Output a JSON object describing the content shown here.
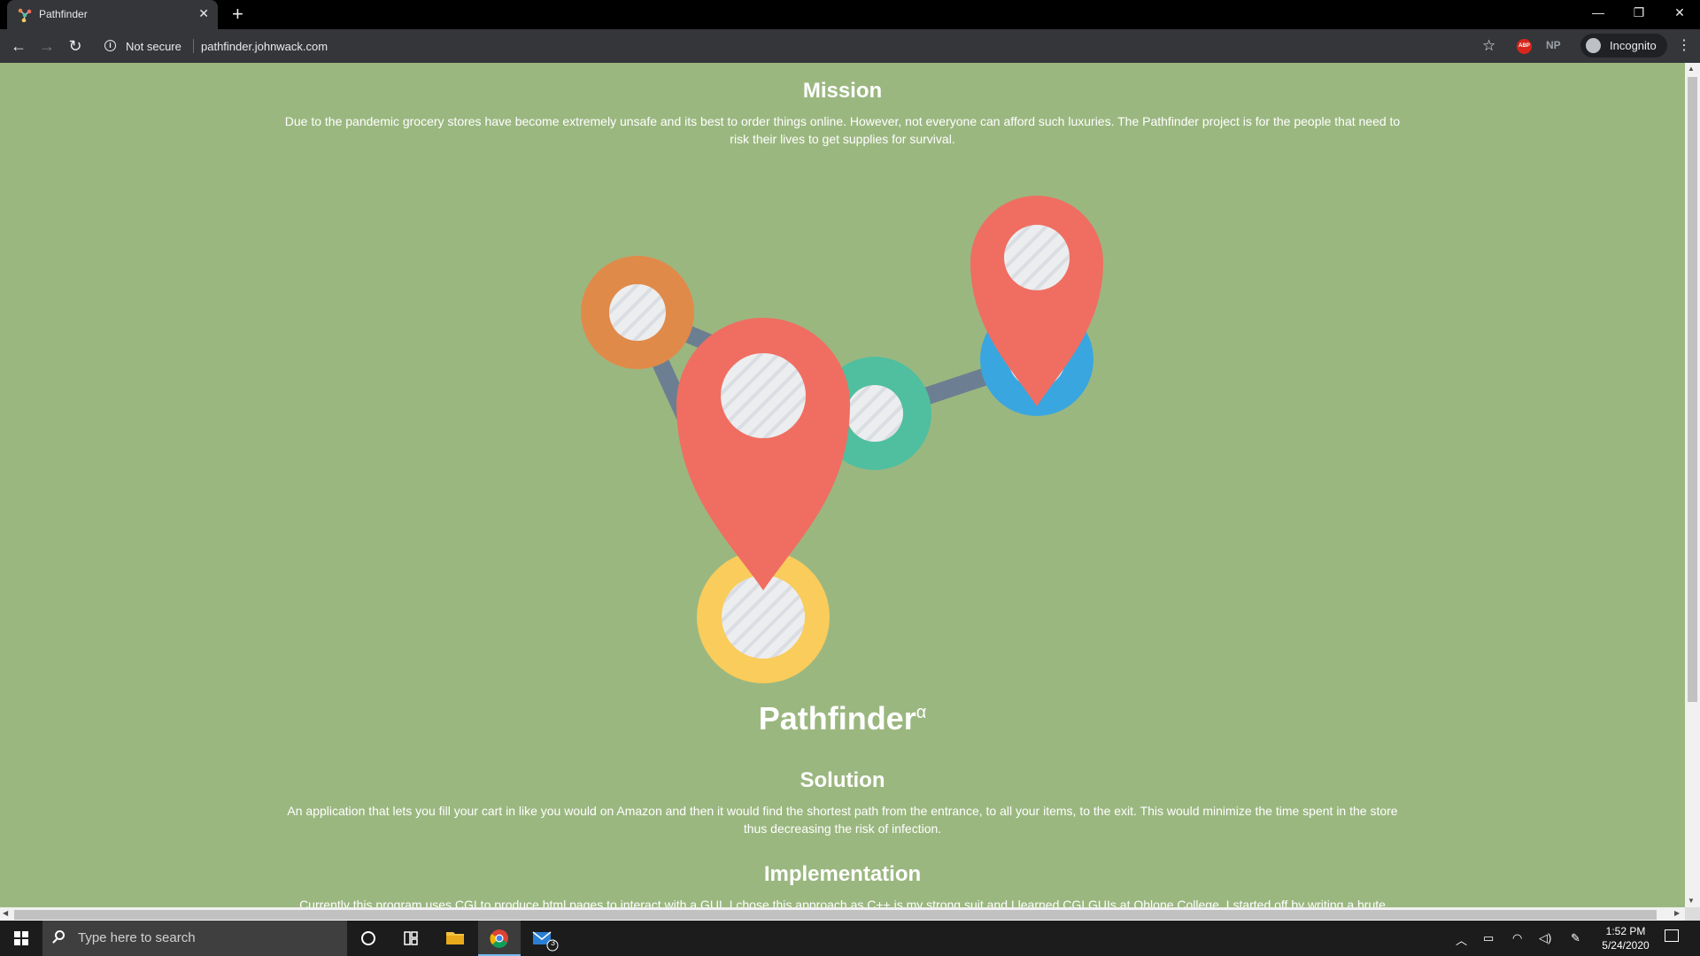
{
  "browser": {
    "tab_title": "Pathfinder",
    "tab_close": "✕",
    "new_tab": "+",
    "window": {
      "minimize": "—",
      "restore": "❐",
      "close": "✕"
    },
    "security_label": "Not secure",
    "url": "pathfinder.johnwack.com",
    "extension_np": "NP",
    "extension_abp": "ABP",
    "profile_label": "Incognito"
  },
  "page": {
    "mission_heading": "Mission",
    "mission_text": "Due to the pandemic grocery stores have become extremely unsafe and its best to order things online. However, not everyone can afford such luxuries. The Pathfinder project is for the people that need to risk their lives to get supplies for survival.",
    "brand_name": "Pathfinder",
    "brand_superscript": "α",
    "solution_heading": "Solution",
    "solution_text": "An application that lets you fill your cart in like you would on Amazon and then it would find the shortest path from the entrance, to all your items, to the exit. This would minimize the time spent in the store thus decreasing the risk of infection.",
    "implementation_heading": "Implementation",
    "implementation_text": "Currently this program uses CGI to produce html pages to interact with a GUI. I chose this approach as C++ is my strong suit and I learned CGI GUIs at Ohlone College. I started off by writing a brute"
  },
  "taskbar": {
    "search_placeholder": "Type here to search",
    "mail_badge": "3",
    "time": "1:52 PM",
    "date": "5/24/2020"
  },
  "colors": {
    "page_background": "#9bb780",
    "pin_red": "#ef6e61",
    "node_orange": "#e08a4a",
    "node_teal": "#4fbf9f",
    "node_blue": "#3aa6e0",
    "node_yellow": "#f9cc5c",
    "edge_gray": "#6c7f92"
  }
}
